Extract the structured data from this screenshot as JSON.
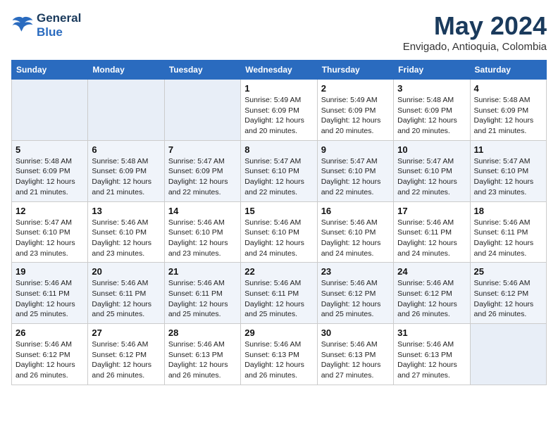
{
  "header": {
    "logo_line1": "General",
    "logo_line2": "Blue",
    "month_title": "May 2024",
    "location": "Envigado, Antioquia, Colombia"
  },
  "weekdays": [
    "Sunday",
    "Monday",
    "Tuesday",
    "Wednesday",
    "Thursday",
    "Friday",
    "Saturday"
  ],
  "weeks": [
    [
      {
        "day": "",
        "info": ""
      },
      {
        "day": "",
        "info": ""
      },
      {
        "day": "",
        "info": ""
      },
      {
        "day": "1",
        "info": "Sunrise: 5:49 AM\nSunset: 6:09 PM\nDaylight: 12 hours\nand 20 minutes."
      },
      {
        "day": "2",
        "info": "Sunrise: 5:49 AM\nSunset: 6:09 PM\nDaylight: 12 hours\nand 20 minutes."
      },
      {
        "day": "3",
        "info": "Sunrise: 5:48 AM\nSunset: 6:09 PM\nDaylight: 12 hours\nand 20 minutes."
      },
      {
        "day": "4",
        "info": "Sunrise: 5:48 AM\nSunset: 6:09 PM\nDaylight: 12 hours\nand 21 minutes."
      }
    ],
    [
      {
        "day": "5",
        "info": "Sunrise: 5:48 AM\nSunset: 6:09 PM\nDaylight: 12 hours\nand 21 minutes."
      },
      {
        "day": "6",
        "info": "Sunrise: 5:48 AM\nSunset: 6:09 PM\nDaylight: 12 hours\nand 21 minutes."
      },
      {
        "day": "7",
        "info": "Sunrise: 5:47 AM\nSunset: 6:09 PM\nDaylight: 12 hours\nand 22 minutes."
      },
      {
        "day": "8",
        "info": "Sunrise: 5:47 AM\nSunset: 6:10 PM\nDaylight: 12 hours\nand 22 minutes."
      },
      {
        "day": "9",
        "info": "Sunrise: 5:47 AM\nSunset: 6:10 PM\nDaylight: 12 hours\nand 22 minutes."
      },
      {
        "day": "10",
        "info": "Sunrise: 5:47 AM\nSunset: 6:10 PM\nDaylight: 12 hours\nand 22 minutes."
      },
      {
        "day": "11",
        "info": "Sunrise: 5:47 AM\nSunset: 6:10 PM\nDaylight: 12 hours\nand 23 minutes."
      }
    ],
    [
      {
        "day": "12",
        "info": "Sunrise: 5:47 AM\nSunset: 6:10 PM\nDaylight: 12 hours\nand 23 minutes."
      },
      {
        "day": "13",
        "info": "Sunrise: 5:46 AM\nSunset: 6:10 PM\nDaylight: 12 hours\nand 23 minutes."
      },
      {
        "day": "14",
        "info": "Sunrise: 5:46 AM\nSunset: 6:10 PM\nDaylight: 12 hours\nand 23 minutes."
      },
      {
        "day": "15",
        "info": "Sunrise: 5:46 AM\nSunset: 6:10 PM\nDaylight: 12 hours\nand 24 minutes."
      },
      {
        "day": "16",
        "info": "Sunrise: 5:46 AM\nSunset: 6:10 PM\nDaylight: 12 hours\nand 24 minutes."
      },
      {
        "day": "17",
        "info": "Sunrise: 5:46 AM\nSunset: 6:11 PM\nDaylight: 12 hours\nand 24 minutes."
      },
      {
        "day": "18",
        "info": "Sunrise: 5:46 AM\nSunset: 6:11 PM\nDaylight: 12 hours\nand 24 minutes."
      }
    ],
    [
      {
        "day": "19",
        "info": "Sunrise: 5:46 AM\nSunset: 6:11 PM\nDaylight: 12 hours\nand 25 minutes."
      },
      {
        "day": "20",
        "info": "Sunrise: 5:46 AM\nSunset: 6:11 PM\nDaylight: 12 hours\nand 25 minutes."
      },
      {
        "day": "21",
        "info": "Sunrise: 5:46 AM\nSunset: 6:11 PM\nDaylight: 12 hours\nand 25 minutes."
      },
      {
        "day": "22",
        "info": "Sunrise: 5:46 AM\nSunset: 6:11 PM\nDaylight: 12 hours\nand 25 minutes."
      },
      {
        "day": "23",
        "info": "Sunrise: 5:46 AM\nSunset: 6:12 PM\nDaylight: 12 hours\nand 25 minutes."
      },
      {
        "day": "24",
        "info": "Sunrise: 5:46 AM\nSunset: 6:12 PM\nDaylight: 12 hours\nand 26 minutes."
      },
      {
        "day": "25",
        "info": "Sunrise: 5:46 AM\nSunset: 6:12 PM\nDaylight: 12 hours\nand 26 minutes."
      }
    ],
    [
      {
        "day": "26",
        "info": "Sunrise: 5:46 AM\nSunset: 6:12 PM\nDaylight: 12 hours\nand 26 minutes."
      },
      {
        "day": "27",
        "info": "Sunrise: 5:46 AM\nSunset: 6:12 PM\nDaylight: 12 hours\nand 26 minutes."
      },
      {
        "day": "28",
        "info": "Sunrise: 5:46 AM\nSunset: 6:13 PM\nDaylight: 12 hours\nand 26 minutes."
      },
      {
        "day": "29",
        "info": "Sunrise: 5:46 AM\nSunset: 6:13 PM\nDaylight: 12 hours\nand 26 minutes."
      },
      {
        "day": "30",
        "info": "Sunrise: 5:46 AM\nSunset: 6:13 PM\nDaylight: 12 hours\nand 27 minutes."
      },
      {
        "day": "31",
        "info": "Sunrise: 5:46 AM\nSunset: 6:13 PM\nDaylight: 12 hours\nand 27 minutes."
      },
      {
        "day": "",
        "info": ""
      }
    ]
  ]
}
